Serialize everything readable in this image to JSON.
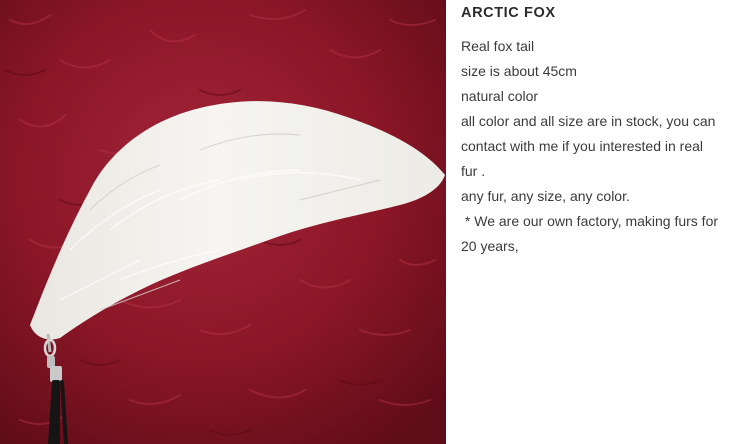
{
  "product": {
    "image": {
      "alt": "White arctic fox tail with a silver clasp and black tassel lying on dark red fur",
      "colors": {
        "background_fur": "#8a1626",
        "tail": "#f2f1ec",
        "clasp": "#c9c9c9",
        "tassel": "#1a1a1a"
      }
    },
    "title": "ARCTIC FOX",
    "description_lines": [
      "Real fox tail",
      "size is about 45cm",
      "natural color",
      "all color and all size are in stock, you can",
      "contact with me if you interested in real",
      "fur .",
      "any fur, any size, any color.",
      " * We are our own factory, making furs for",
      "20 years,"
    ]
  }
}
